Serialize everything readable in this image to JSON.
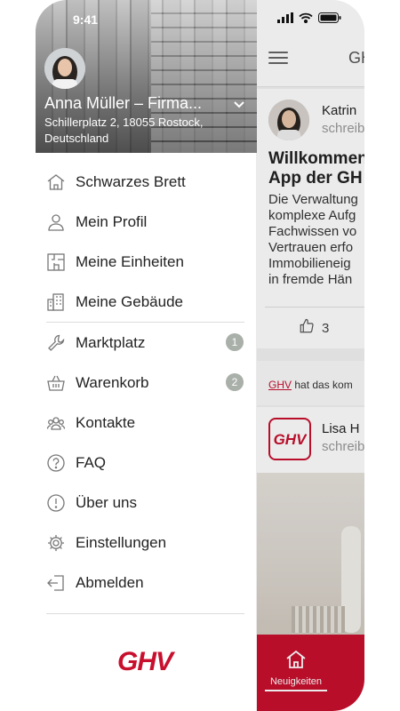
{
  "status_bar": {
    "time": "9:41"
  },
  "drawer": {
    "user_name": "Anna Müller – Firma...",
    "address": "Schillerplatz 2, 18055 Rostock, Deutschland",
    "items": [
      {
        "label": "Schwarzes Brett",
        "icon": "home-icon"
      },
      {
        "label": "Mein Profil",
        "icon": "person-icon"
      },
      {
        "label": "Meine Einheiten",
        "icon": "floorplan-icon"
      },
      {
        "label": "Meine Gebäude",
        "icon": "building-icon"
      },
      {
        "label": "Marktplatz",
        "icon": "wrench-icon",
        "badge": "1"
      },
      {
        "label": "Warenkorb",
        "icon": "basket-icon",
        "badge": "2"
      },
      {
        "label": "Kontakte",
        "icon": "group-icon"
      },
      {
        "label": "FAQ",
        "icon": "question-icon"
      },
      {
        "label": "Über uns",
        "icon": "info-icon"
      },
      {
        "label": "Einstellungen",
        "icon": "gear-icon"
      },
      {
        "label": "Abmelden",
        "icon": "logout-icon"
      }
    ],
    "logo_text": "GHV"
  },
  "app": {
    "header_title": "GH",
    "post": {
      "author": "Katrin",
      "author_sub": "schreib",
      "title": "Willkommen\nApp der GH",
      "body": "Die Verwaltung\nkomplexe Aufg\nFachwissen vo\nVertrauen erfo\nImmobilieneig\nin fremde Hän",
      "likes": "3"
    },
    "notice": {
      "link": "GHV",
      "text": " hat das kom"
    },
    "post2": {
      "author": "Lisa H",
      "author_sub": "schreib"
    },
    "bottom_nav": {
      "label": "Neuigkeiten"
    }
  },
  "colors": {
    "brand": "#c8102e",
    "badge": "#a9afa9"
  }
}
